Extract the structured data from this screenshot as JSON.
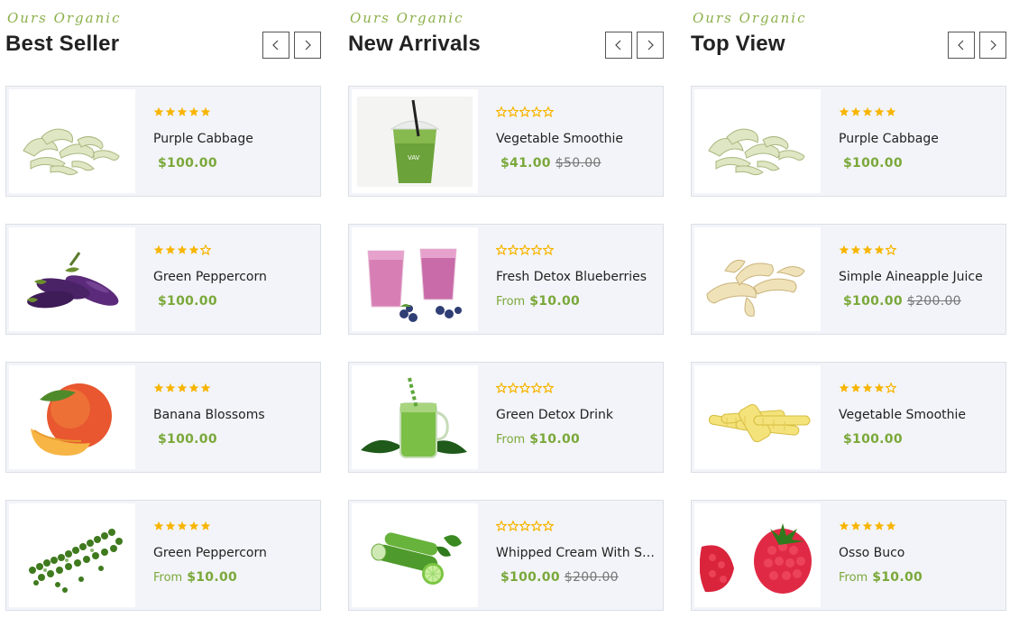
{
  "columns": [
    {
      "eyebrow": "Ours Organic",
      "title": "Best Seller",
      "products": [
        {
          "name": "Purple Cabbage",
          "price": "$100.00",
          "old_price": "",
          "from": "",
          "rating": 5,
          "image": "white-cabbage-strips"
        },
        {
          "name": "Green Peppercorn",
          "price": "$100.00",
          "old_price": "",
          "from": "",
          "rating": 4,
          "image": "eggplants"
        },
        {
          "name": "Banana Blossoms",
          "price": "$100.00",
          "old_price": "",
          "from": "",
          "rating": 5,
          "image": "peach"
        },
        {
          "name": "Green Peppercorn",
          "price": "$10.00",
          "old_price": "",
          "from": "From",
          "rating": 5,
          "image": "green-peppercorn"
        }
      ]
    },
    {
      "eyebrow": "Ours Organic",
      "title": "New Arrivals",
      "products": [
        {
          "name": "Vegetable Smoothie",
          "price": "$41.00",
          "old_price": "$50.00",
          "from": "",
          "rating": 0,
          "image": "green-smoothie-cup"
        },
        {
          "name": "Fresh Detox Blueberries",
          "price": "$10.00",
          "old_price": "",
          "from": "From",
          "rating": 0,
          "image": "berry-smoothies"
        },
        {
          "name": "Green Detox Drink",
          "price": "$10.00",
          "old_price": "",
          "from": "From",
          "rating": 0,
          "image": "green-detox-jar"
        },
        {
          "name": "Whipped Cream With St...",
          "price": "$100.00",
          "old_price": "$200.00",
          "from": "",
          "rating": 0,
          "image": "cucumber-lime"
        }
      ]
    },
    {
      "eyebrow": "Ours Organic",
      "title": "Top View",
      "products": [
        {
          "name": "Purple Cabbage",
          "price": "$100.00",
          "old_price": "",
          "from": "",
          "rating": 5,
          "image": "white-cabbage-strips"
        },
        {
          "name": "Simple Aineapple Juice",
          "price": "$100.00",
          "old_price": "$200.00",
          "from": "",
          "rating": 4,
          "image": "ginger"
        },
        {
          "name": "Vegetable Smoothie",
          "price": "$100.00",
          "old_price": "",
          "from": "",
          "rating": 4,
          "image": "baby-corn"
        },
        {
          "name": "Osso Buco",
          "price": "$10.00",
          "old_price": "",
          "from": "From",
          "rating": 5,
          "image": "raspberries"
        }
      ]
    }
  ],
  "icons": {
    "prev": "chevron-left-icon",
    "next": "chevron-right-icon",
    "star": "star-icon"
  },
  "colors": {
    "accent_green": "#7aa83a",
    "star": "#f7b500",
    "card_bg": "#f3f4f9"
  }
}
